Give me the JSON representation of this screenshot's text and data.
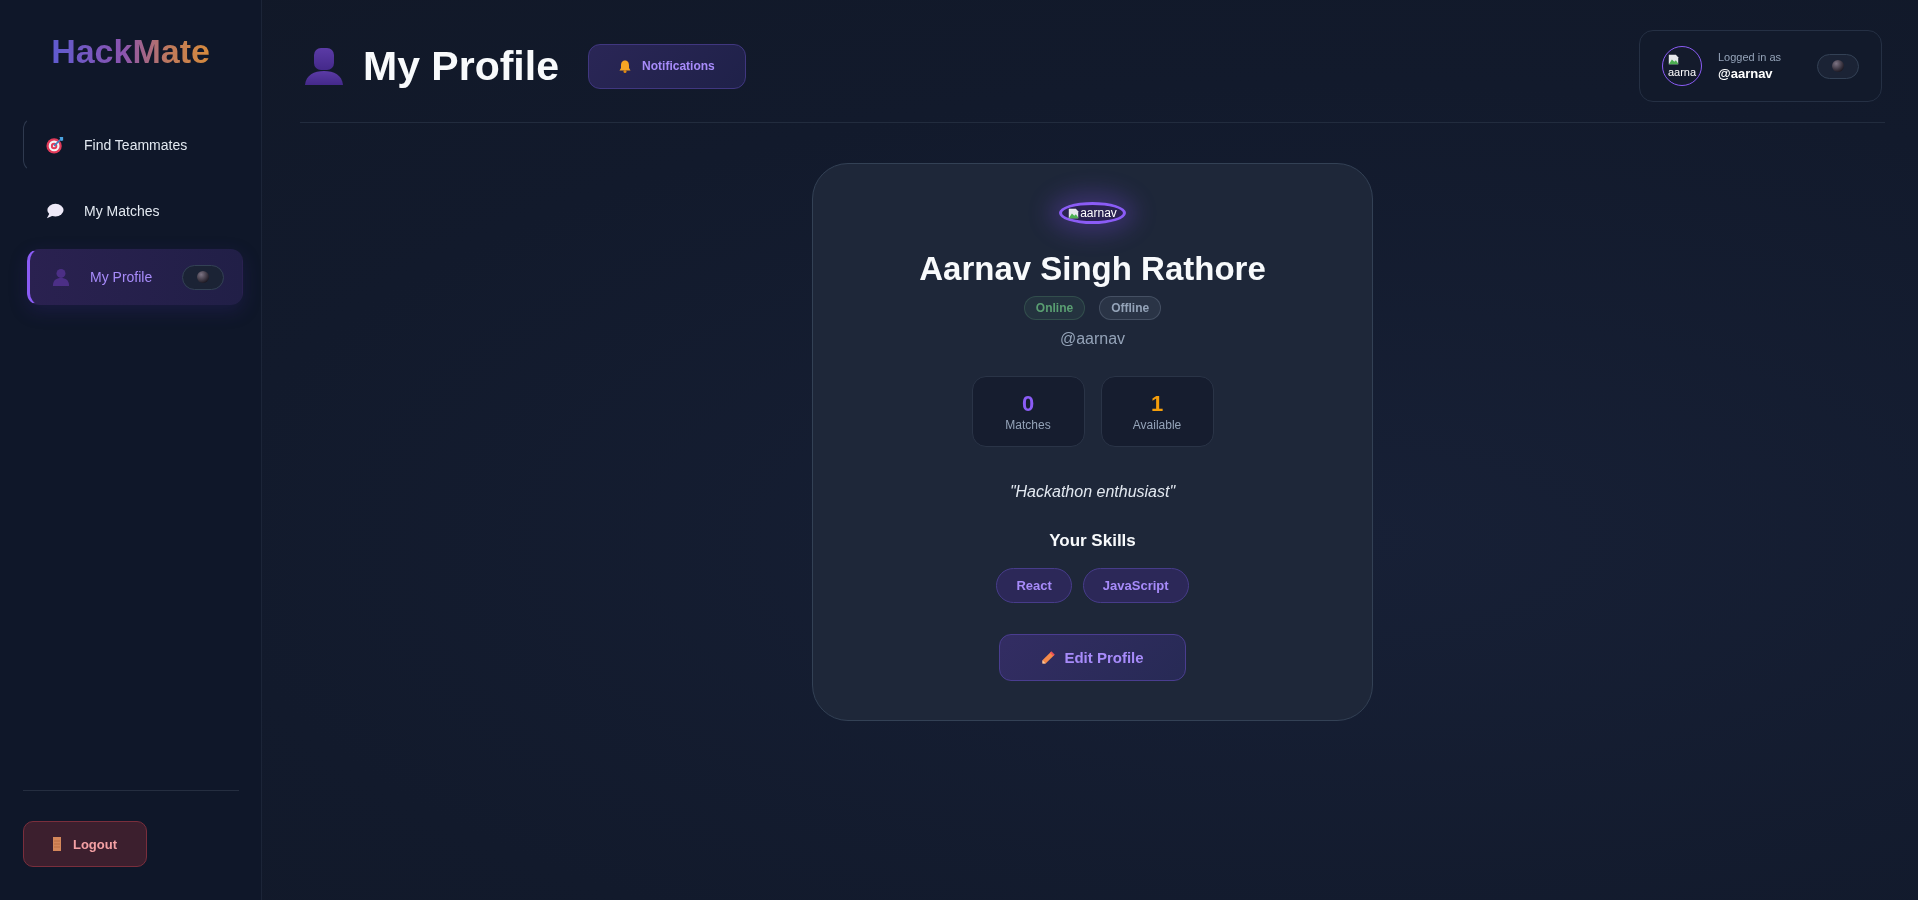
{
  "sidebar": {
    "logo": "HackMate",
    "items": [
      {
        "label": "Find Teammates",
        "selected": false,
        "focused": true,
        "theme_button": false
      },
      {
        "label": "My Matches",
        "selected": false,
        "focused": false,
        "theme_button": false
      },
      {
        "label": "My Profile",
        "selected": true,
        "focused": false,
        "theme_button": true
      }
    ],
    "logout": "Logout"
  },
  "header": {
    "title": "My Profile",
    "notifications": "Notifications",
    "user": {
      "avatar_alt": "aarna",
      "caption": "Logged in as",
      "handle": "@aarnav",
      "theme_button": true
    }
  },
  "profile": {
    "avatar_alt": "aarnav",
    "name": "Aarnav Singh Rathore",
    "status_badges": [
      {
        "label": "Online",
        "color": "#5a9f72"
      },
      {
        "label": "Offline",
        "color": "#94a3b8"
      }
    ],
    "handle": "@aarnav",
    "stats": [
      {
        "value": "0",
        "label": "Matches",
        "color": "#8b5cf6"
      },
      {
        "value": "1",
        "label": "Available",
        "color": "#f59e0b"
      }
    ],
    "bio": "\"Hackathon enthusiast\"",
    "skills_title": "Your Skills",
    "skills": [
      "React",
      "JavaScript"
    ],
    "edit_button": "Edit Profile"
  }
}
